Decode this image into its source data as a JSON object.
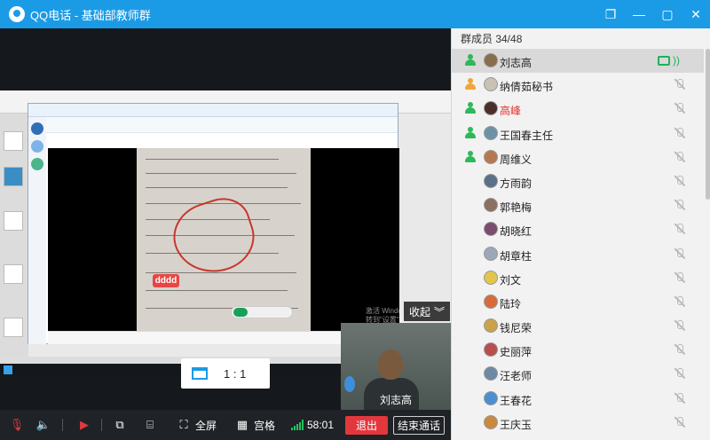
{
  "window": {
    "title": "QQ电话 - 基础部教师群",
    "controls": [
      "❐",
      "—",
      "▢",
      "✕"
    ]
  },
  "stage": {
    "annotation_label": "dddd",
    "shrink_label": "收起",
    "watermark": "激活 Windo\n转到\"设置\"以激"
  },
  "ratio": {
    "label": "1 : 1"
  },
  "camera": {
    "name": "刘志高"
  },
  "bottom_bar": {
    "fullscreen_label": "全屏",
    "grid_label": "宫格",
    "timer": "58:01",
    "exit_label": "退出",
    "end_call_label": "结束通话"
  },
  "panel": {
    "header": "群成员 34/48",
    "members": [
      {
        "name": "刘志高",
        "role": "admin",
        "highlight": false
      },
      {
        "name": "纳倩茹秘书",
        "role": "owner",
        "highlight": false
      },
      {
        "name": "高峰",
        "role": "admin",
        "highlight": true
      },
      {
        "name": "王国春主任",
        "role": "admin",
        "highlight": false
      },
      {
        "name": "周维义",
        "role": "admin",
        "highlight": false
      },
      {
        "name": "方雨韵",
        "role": "member",
        "highlight": false
      },
      {
        "name": "郭艳梅",
        "role": "member",
        "highlight": false
      },
      {
        "name": "胡晓红",
        "role": "member",
        "highlight": false
      },
      {
        "name": "胡章柱",
        "role": "member",
        "highlight": false
      },
      {
        "name": "刘文",
        "role": "member",
        "highlight": false
      },
      {
        "name": "陆玲",
        "role": "member",
        "highlight": false
      },
      {
        "name": "钱尼荣",
        "role": "member",
        "highlight": false
      },
      {
        "name": "史丽萍",
        "role": "member",
        "highlight": false
      },
      {
        "name": "汪老师",
        "role": "member",
        "highlight": false
      },
      {
        "name": "王春花",
        "role": "member",
        "highlight": false
      },
      {
        "name": "王庆玉",
        "role": "member",
        "highlight": false
      }
    ]
  },
  "colors": {
    "titlebar": "#1b9be6",
    "exit_button": "#e2383d",
    "highlight_name": "#e5322d",
    "speaking": "#1fb25a"
  }
}
